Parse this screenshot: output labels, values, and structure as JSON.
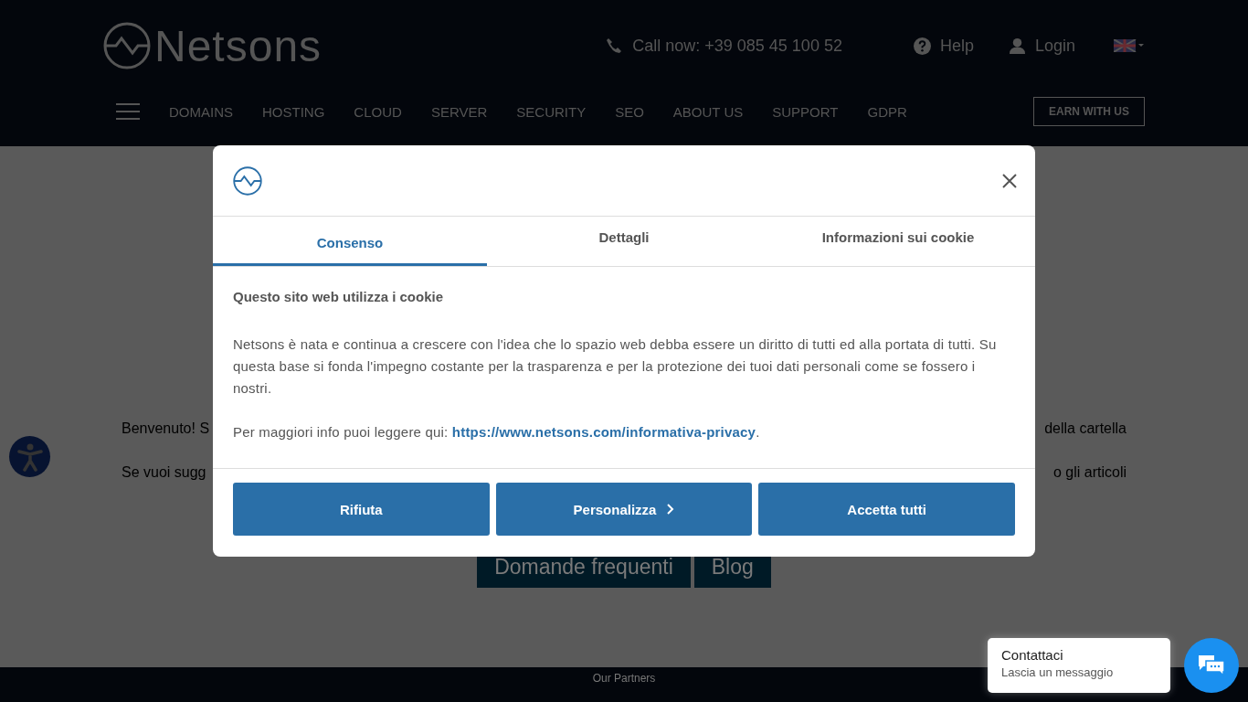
{
  "header": {
    "brand": "Netsons",
    "phone": "Call now: +39 085 45 100 52",
    "help": "Help",
    "login": "Login",
    "nav": [
      "DOMAINS",
      "HOSTING",
      "CLOUD",
      "SERVER",
      "SECURITY",
      "SEO",
      "ABOUT US",
      "SUPPORT",
      "GDPR"
    ],
    "cta": "EARN WITH US"
  },
  "content": {
    "lines": [
      {
        "left": "Benvenuto! S",
        "right": "della cartella"
      },
      {
        "left": "Se vuoi sugg",
        "right": "o gli articoli"
      }
    ],
    "buttons": [
      "Domande frequenti",
      "Blog"
    ]
  },
  "footer": {
    "text": "Our Partners"
  },
  "cookie_dialog": {
    "tabs": [
      {
        "label": "Consenso",
        "selected": true
      },
      {
        "label": "Dettagli",
        "selected": false
      },
      {
        "label": "Informazioni sui cookie",
        "selected": false
      }
    ],
    "heading": "Questo sito web utilizza i cookie",
    "paragraph": "Netsons è nata e continua a crescere con l'idea che lo spazio web debba essere un diritto di tutti ed alla portata di tutti. Su questa base si fonda l'impegno costante per la trasparenza e per la protezione dei tuoi dati personali come se fossero i nostri.",
    "more_prefix": "Per maggiori info puoi leggere qui:",
    "more_link": "https://www.netsons.com/informativa-privacy",
    "more_suffix": ".",
    "buttons": [
      {
        "label": "Rifiuta",
        "kind": "plain"
      },
      {
        "label": "Personalizza",
        "kind": "chevron"
      },
      {
        "label": "Accetta tutti",
        "kind": "plain"
      }
    ]
  },
  "chat": {
    "title": "Contattaci",
    "subtitle": "Lascia un messaggio"
  }
}
